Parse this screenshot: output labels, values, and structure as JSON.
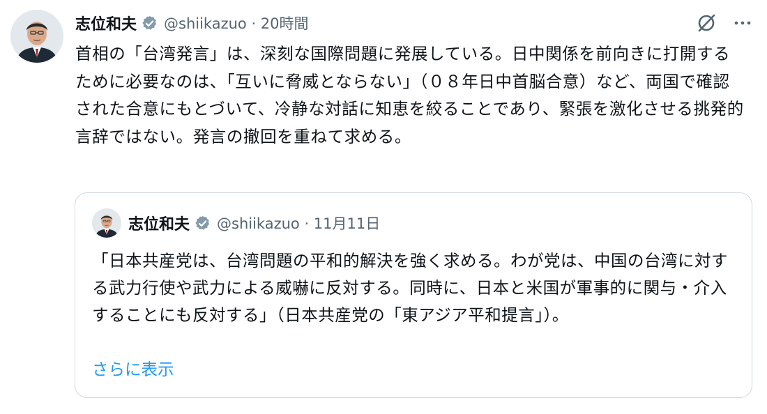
{
  "tweet": {
    "author_name": "志位和夫",
    "handle_time": "@shiikazuo · 20時間",
    "text": "首相の「台湾発言」は、深刻な国際問題に発展している。日中関係を前向きに打開するために必要なのは、「互いに脅威とならない」（０８年日中首脳合意）など、両国で確認された合意にもとづいて、冷静な対話に知恵を絞ることであり、緊張を激化させる挑発的言辞ではない。発言の撤回を重ねて求める。"
  },
  "quoted_tweet": {
    "author_name": "志位和夫",
    "handle_time": "@shiikazuo · 11月11日",
    "text": "「日本共産党は、台湾問題の平和的解決を強く求める。わが党は、中国の台湾に対する武力行使や武力による威嚇に反対する。同時に、日本と米国が軍事的に関与・介入することにも反対する」（日本共産党の「東アジア平和提言」）。",
    "show_more": "さらに表示"
  },
  "icons": {
    "verified": "verified-badge-icon",
    "grok": "grok-icon",
    "more": "more-icon"
  },
  "colors": {
    "text": "#0f1419",
    "secondary": "#536471",
    "link": "#1d9bf0",
    "verified_badge": "#829aab",
    "border": "#cfd9de"
  }
}
